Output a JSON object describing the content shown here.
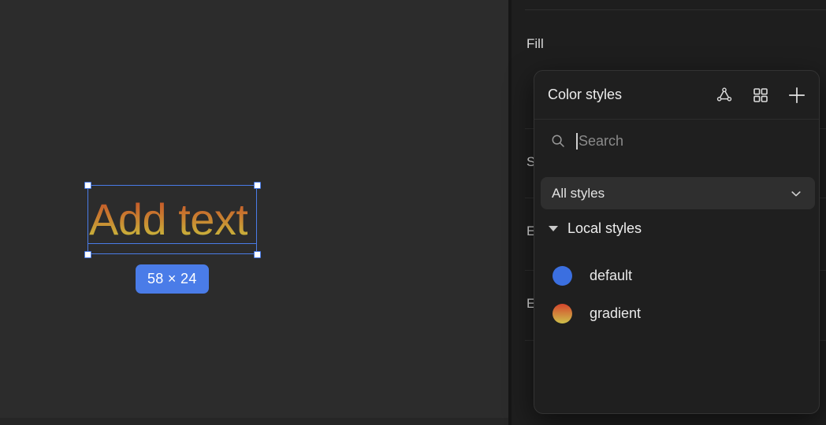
{
  "canvas": {
    "artboard_text": "Add text",
    "text_gradient_from": "#c24b27",
    "text_gradient_to": "#c3b93f",
    "selection_color": "#4a7ce8",
    "size_badge": "58 × 24"
  },
  "right_panel": {
    "sections": [
      {
        "label": "Fill"
      },
      {
        "label": "S"
      },
      {
        "label": "E"
      },
      {
        "label": "E"
      }
    ],
    "fill": {
      "label": "Fill",
      "styles_toggle_icon": "four-dots-icon",
      "add_icon": "plus-icon"
    }
  },
  "popover": {
    "title": "Color styles",
    "header_icons": [
      {
        "name": "vector-node-icon"
      },
      {
        "name": "grid-view-icon"
      },
      {
        "name": "plus-icon"
      }
    ],
    "search": {
      "placeholder": "Search",
      "value": "",
      "icon": "search-icon"
    },
    "filter": {
      "selected": "All styles",
      "chevron": "chevron-down-icon"
    },
    "group": {
      "label": "Local styles",
      "expanded": true
    },
    "styles": [
      {
        "name": "default",
        "swatch_type": "solid",
        "color": "#3b6fe0"
      },
      {
        "name": "gradient",
        "swatch_type": "gradient",
        "color_from": "#d4452c",
        "color_to": "#cfc04a"
      }
    ]
  }
}
